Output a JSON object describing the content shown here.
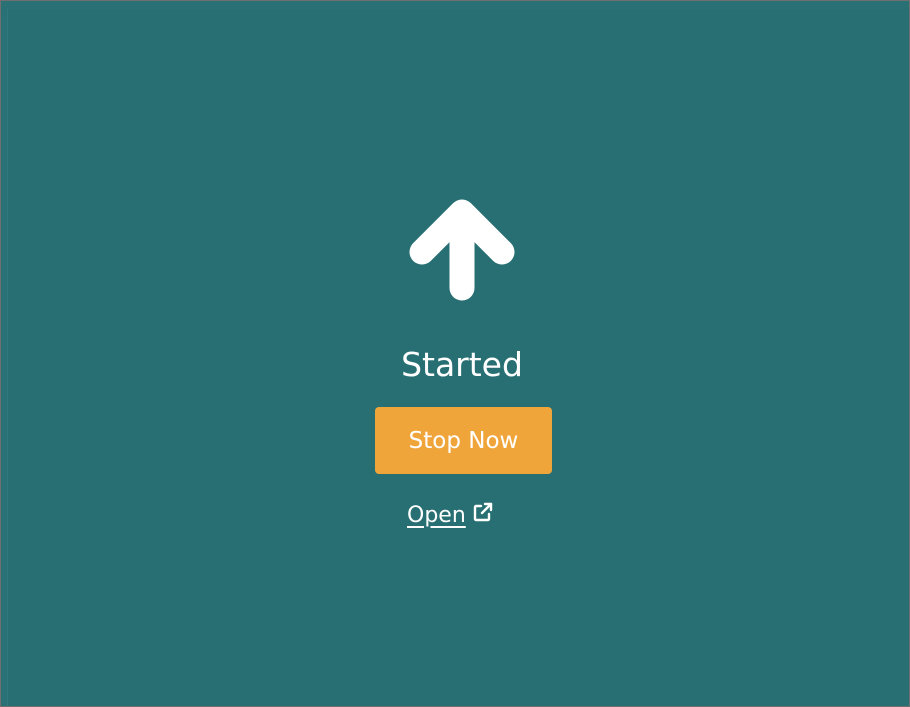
{
  "status": {
    "icon": "arrow-up-icon",
    "text": "Started"
  },
  "actions": {
    "stop_label": "Stop Now",
    "open_label": "Open",
    "open_icon": "external-link-icon"
  },
  "colors": {
    "background": "#2a7175",
    "button": "#f0a53b",
    "text": "#ffffff"
  }
}
